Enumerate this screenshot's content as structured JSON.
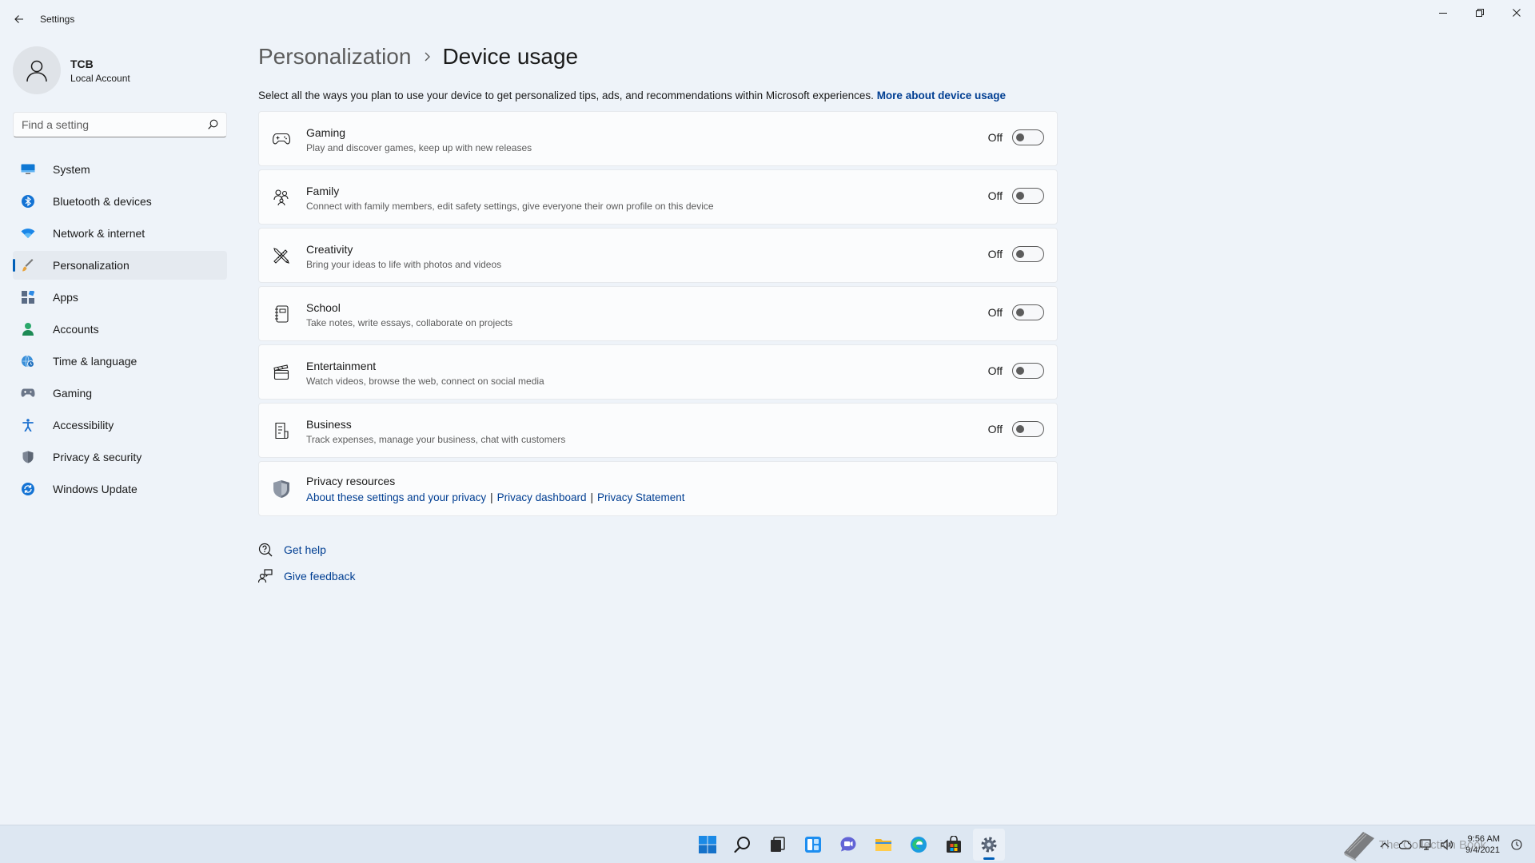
{
  "window": {
    "title": "Settings"
  },
  "user": {
    "name": "TCB",
    "account_type": "Local Account"
  },
  "search": {
    "placeholder": "Find a setting",
    "value": ""
  },
  "nav": {
    "items": [
      {
        "label": "System",
        "icon": "monitor-icon"
      },
      {
        "label": "Bluetooth & devices",
        "icon": "bluetooth-icon"
      },
      {
        "label": "Network & internet",
        "icon": "wifi-icon"
      },
      {
        "label": "Personalization",
        "icon": "brush-icon",
        "active": true
      },
      {
        "label": "Apps",
        "icon": "apps-icon"
      },
      {
        "label": "Accounts",
        "icon": "person-icon"
      },
      {
        "label": "Time & language",
        "icon": "globe-clock-icon"
      },
      {
        "label": "Gaming",
        "icon": "controller-icon"
      },
      {
        "label": "Accessibility",
        "icon": "accessibility-icon"
      },
      {
        "label": "Privacy & security",
        "icon": "shield-icon"
      },
      {
        "label": "Windows Update",
        "icon": "update-icon"
      }
    ]
  },
  "breadcrumb": {
    "parent": "Personalization",
    "current": "Device usage"
  },
  "description": {
    "text": "Select all the ways you plan to use your device to get personalized tips, ads, and recommendations within Microsoft experiences.",
    "link": "More about device usage"
  },
  "usages": [
    {
      "title": "Gaming",
      "subtitle": "Play and discover games, keep up with new releases",
      "state": "Off",
      "icon": "gamepad-icon"
    },
    {
      "title": "Family",
      "subtitle": "Connect with family members, edit safety settings, give everyone their own profile on this device",
      "state": "Off",
      "icon": "family-icon"
    },
    {
      "title": "Creativity",
      "subtitle": "Bring your ideas to life with photos and videos",
      "state": "Off",
      "icon": "pen-ruler-icon"
    },
    {
      "title": "School",
      "subtitle": "Take notes, write essays, collaborate on projects",
      "state": "Off",
      "icon": "notebook-icon"
    },
    {
      "title": "Entertainment",
      "subtitle": "Watch videos, browse the web, connect on social media",
      "state": "Off",
      "icon": "clapperboard-icon"
    },
    {
      "title": "Business",
      "subtitle": "Track expenses, manage your business, chat with customers",
      "state": "Off",
      "icon": "receipt-icon"
    }
  ],
  "privacy": {
    "title": "Privacy resources",
    "links": [
      "About these settings and your privacy",
      "Privacy dashboard",
      "Privacy Statement"
    ]
  },
  "help": {
    "get_help": "Get help",
    "give_feedback": "Give feedback"
  },
  "taskbar": {
    "apps": [
      "start-icon",
      "search-icon",
      "task-view-icon",
      "widgets-icon",
      "chat-icon",
      "file-explorer-icon",
      "edge-icon",
      "store-icon",
      "settings-icon"
    ],
    "watermark": "The Collection Book",
    "time": "9:56 AM",
    "date": "9/4/2021"
  },
  "colors": {
    "accent": "#005fb8",
    "link": "#003e92",
    "background": "#eef3f9",
    "card": "#fbfcfd"
  }
}
